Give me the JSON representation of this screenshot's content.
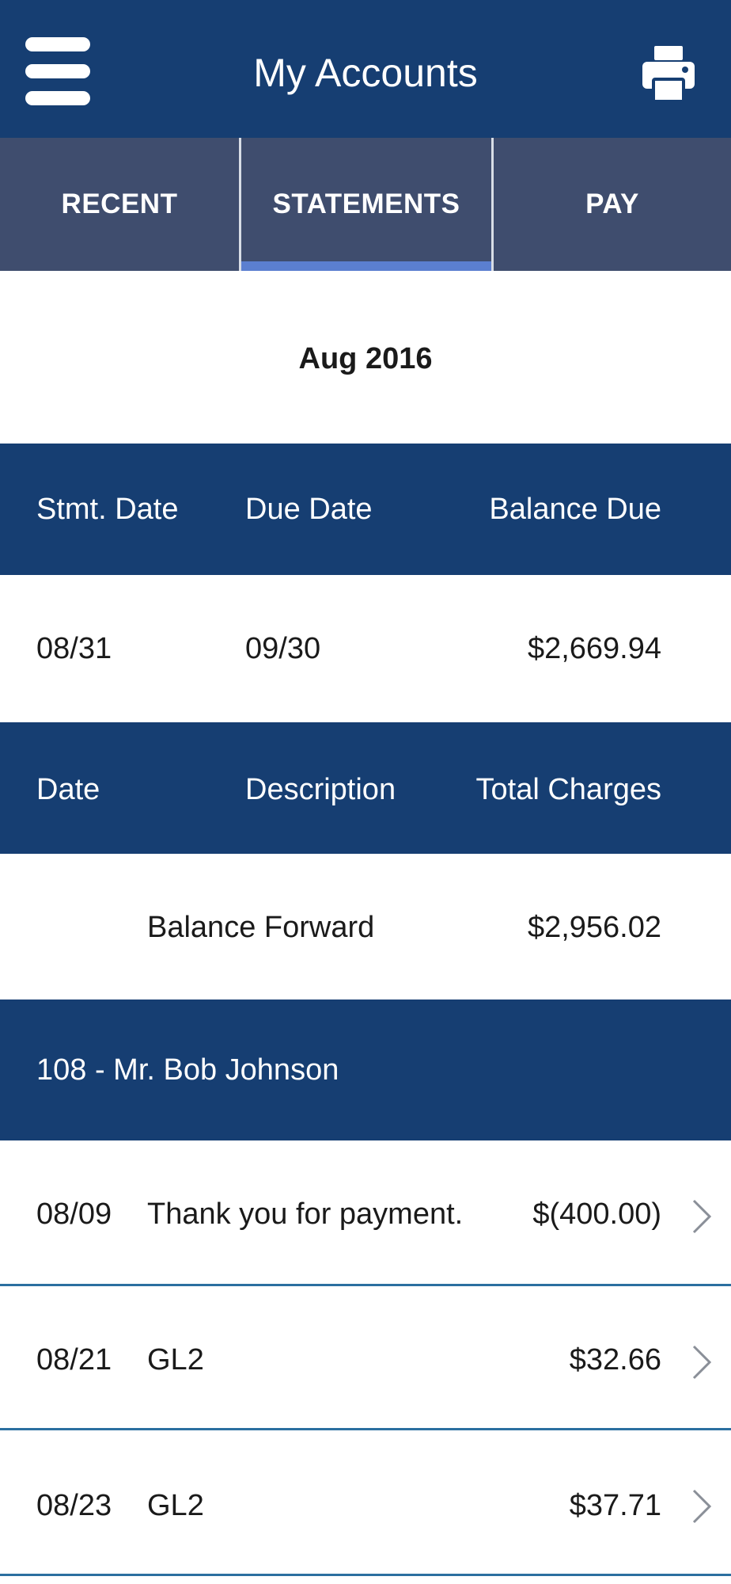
{
  "header": {
    "title": "My Accounts",
    "menu_icon": "hamburger-menu-icon",
    "print_icon": "printer-icon"
  },
  "tabs": [
    {
      "label": "RECENT",
      "active": false
    },
    {
      "label": "STATEMENTS",
      "active": true
    },
    {
      "label": "PAY",
      "active": false
    }
  ],
  "statement": {
    "month": "Aug 2016",
    "summary_headers": {
      "stmt_date": "Stmt. Date",
      "due_date": "Due Date",
      "balance_due": "Balance Due"
    },
    "summary": {
      "stmt_date": "08/31",
      "due_date": "09/30",
      "balance_due": "$2,669.94"
    },
    "detail_headers": {
      "date": "Date",
      "description": "Description",
      "total_charges": "Total Charges"
    },
    "balance_forward": {
      "label": "Balance Forward",
      "amount": "$2,956.02"
    },
    "member": "108 - Mr. Bob Johnson",
    "transactions": [
      {
        "date": "08/09",
        "description": "Thank you for payment.",
        "amount": "$(400.00)"
      },
      {
        "date": "08/21",
        "description": "GL2",
        "amount": "$32.66"
      },
      {
        "date": "08/23",
        "description": "GL2",
        "amount": "$37.71"
      }
    ]
  },
  "colors": {
    "header_blue": "#163e72",
    "tab_gray_blue": "#3f4d6e",
    "tab_indicator": "#5b7fd0",
    "row_divider": "#2b6fa0"
  }
}
